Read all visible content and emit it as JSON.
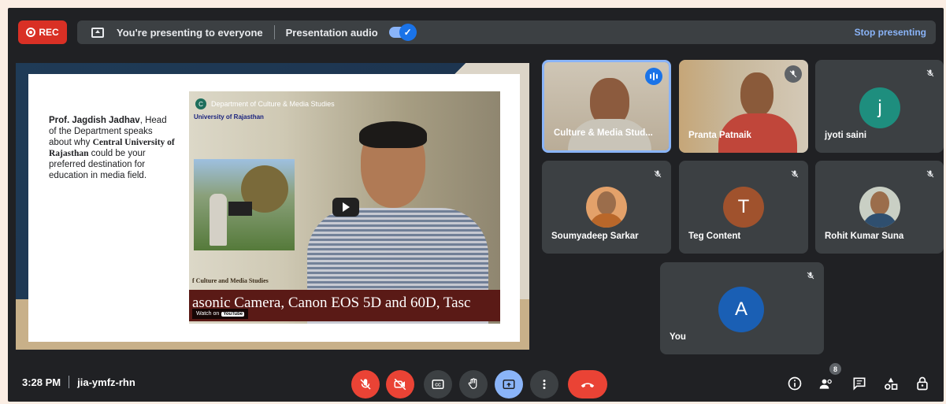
{
  "topbar": {
    "rec_label": "REC",
    "presenting_text": "You're presenting to everyone",
    "audio_label": "Presentation audio",
    "stop_label": "Stop presenting",
    "accent": "#8ab4f8",
    "rec_color": "#d93025"
  },
  "slide": {
    "name": "Prof. Jagdish Jadhav",
    "line1_after_name": ",",
    "text_a": "Head of the Department speaks about why ",
    "univ": "Central University of Rajasthan",
    "text_b": " could be your preferred destination for education in media field."
  },
  "video": {
    "channel_logo": "C",
    "title": "Department of Culture & Media Studies",
    "univ_line1": "University of Rajasthan",
    "caption_small": "f Culture and Media Studies",
    "caption_large": "asonic Camera, Canon EOS 5D and 60D, Tasc",
    "watch_label": "Watch on",
    "yt_label": "YouTube"
  },
  "participants": [
    {
      "name": "Culture & Media Stud...",
      "type": "video",
      "speaking": true
    },
    {
      "name": "Pranta Patnaik",
      "type": "video",
      "muted": true
    },
    {
      "name": "jyoti saini",
      "initial": "j",
      "color": "#1e8e7e",
      "muted": true
    },
    {
      "name": "Soumyadeep Sarkar",
      "type": "photo",
      "muted": true
    },
    {
      "name": "Teg Content",
      "initial": "T",
      "color": "#a0522d",
      "muted": true
    },
    {
      "name": "Rohit Kumar Suna",
      "type": "photo",
      "muted": true
    },
    {
      "name": "You",
      "initial": "A",
      "color": "#1a5fb4",
      "muted": true
    }
  ],
  "bottombar": {
    "time": "3:28 PM",
    "meeting_code": "jia-ymfz-rhn",
    "people_count": "8"
  }
}
